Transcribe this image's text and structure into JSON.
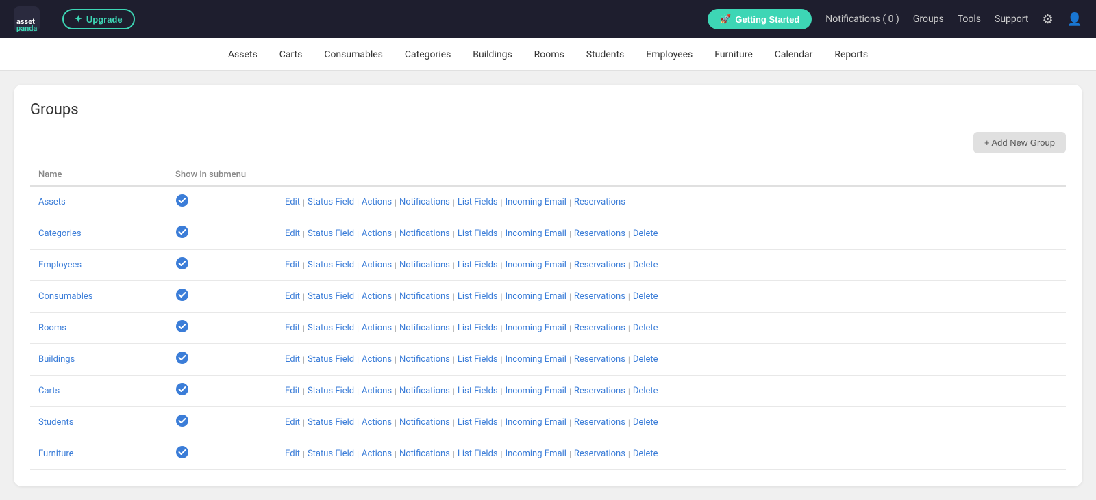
{
  "logo": {
    "text": "asset panda",
    "alt": "Asset Panda"
  },
  "upgrade_btn": "Upgrade",
  "getting_started_btn": "Getting Started",
  "nav_notifications": "Notifications ( 0 )",
  "nav_groups": "Groups",
  "nav_tools": "Tools",
  "nav_support": "Support",
  "secondary_nav": [
    "Assets",
    "Carts",
    "Consumables",
    "Categories",
    "Buildings",
    "Rooms",
    "Students",
    "Employees",
    "Furniture",
    "Calendar",
    "Reports"
  ],
  "page_title": "Groups",
  "add_btn_label": "+ Add New Group",
  "table": {
    "col_name": "Name",
    "col_show": "Show in submenu",
    "rows": [
      {
        "name": "Assets",
        "show_in_submenu": true,
        "actions": [
          "Edit",
          "Status Field",
          "Actions",
          "Notifications",
          "List Fields",
          "Incoming Email",
          "Reservations"
        ],
        "has_delete": false
      },
      {
        "name": "Categories",
        "show_in_submenu": true,
        "actions": [
          "Edit",
          "Status Field",
          "Actions",
          "Notifications",
          "List Fields",
          "Incoming Email",
          "Reservations",
          "Delete"
        ],
        "has_delete": true
      },
      {
        "name": "Employees",
        "show_in_submenu": true,
        "actions": [
          "Edit",
          "Status Field",
          "Actions",
          "Notifications",
          "List Fields",
          "Incoming Email",
          "Reservations",
          "Delete"
        ],
        "has_delete": true
      },
      {
        "name": "Consumables",
        "show_in_submenu": true,
        "actions": [
          "Edit",
          "Status Field",
          "Actions",
          "Notifications",
          "List Fields",
          "Incoming Email",
          "Reservations",
          "Delete"
        ],
        "has_delete": true
      },
      {
        "name": "Rooms",
        "show_in_submenu": true,
        "actions": [
          "Edit",
          "Status Field",
          "Actions",
          "Notifications",
          "List Fields",
          "Incoming Email",
          "Reservations",
          "Delete"
        ],
        "has_delete": true
      },
      {
        "name": "Buildings",
        "show_in_submenu": true,
        "actions": [
          "Edit",
          "Status Field",
          "Actions",
          "Notifications",
          "List Fields",
          "Incoming Email",
          "Reservations",
          "Delete"
        ],
        "has_delete": true
      },
      {
        "name": "Carts",
        "show_in_submenu": true,
        "actions": [
          "Edit",
          "Status Field",
          "Actions",
          "Notifications",
          "List Fields",
          "Incoming Email",
          "Reservations",
          "Delete"
        ],
        "has_delete": true
      },
      {
        "name": "Students",
        "show_in_submenu": true,
        "actions": [
          "Edit",
          "Status Field",
          "Actions",
          "Notifications",
          "List Fields",
          "Incoming Email",
          "Reservations",
          "Delete"
        ],
        "has_delete": true
      },
      {
        "name": "Furniture",
        "show_in_submenu": true,
        "actions": [
          "Edit",
          "Status Field",
          "Actions",
          "Notifications",
          "List Fields",
          "Incoming Email",
          "Reservations",
          "Delete"
        ],
        "has_delete": true
      }
    ]
  }
}
